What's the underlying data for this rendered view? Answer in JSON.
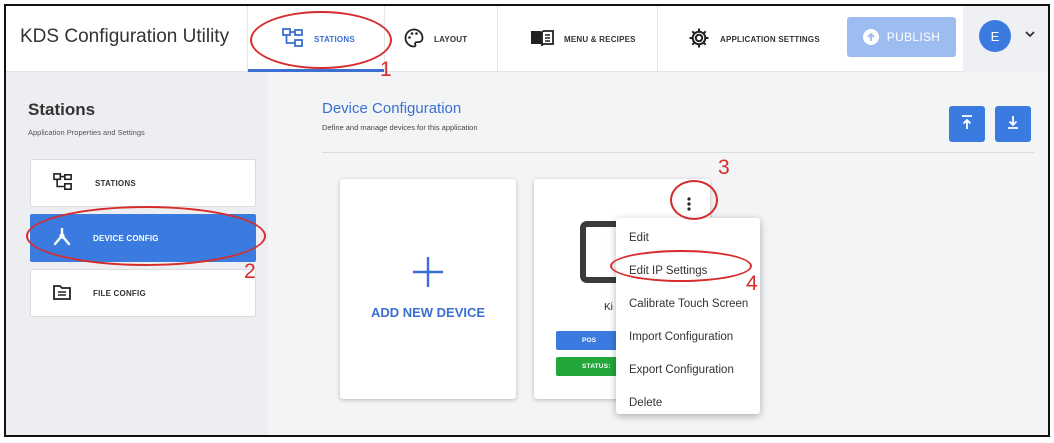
{
  "app": {
    "title": "KDS Configuration Utility"
  },
  "nav": {
    "stations": "STATIONS",
    "layout": "LAYOUT",
    "menu_recipes": "MENU & RECIPES",
    "app_settings": "APPLICATION SETTINGS"
  },
  "publish": {
    "label": "PUBLISH"
  },
  "user": {
    "initial": "E"
  },
  "sidebar": {
    "title": "Stations",
    "subtitle": "Application Properties and Settings",
    "items": [
      {
        "label": "STATIONS",
        "icon": "sitemap-icon",
        "active": false
      },
      {
        "label": "DEVICE CONFIG",
        "icon": "device-network-icon",
        "active": true
      },
      {
        "label": "FILE CONFIG",
        "icon": "file-list-icon",
        "active": false
      }
    ]
  },
  "main": {
    "title": "Device Configuration",
    "subtitle": "Define and manage devices for this application",
    "add_device_label": "ADD NEW DEVICE",
    "device": {
      "name_visible": "Ki",
      "badge1_visible": "POS",
      "badge2_visible": "STATUS:"
    }
  },
  "menu": {
    "items": [
      "Edit",
      "Edit IP Settings",
      "Calibrate Touch Screen",
      "Import Configuration",
      "Export Configuration",
      "Delete"
    ]
  },
  "annotations": [
    "1",
    "2",
    "3",
    "4"
  ],
  "colors": {
    "accent": "#3b7be0",
    "nav_active": "#3b6fd1",
    "publish_disabled": "#9dbcf0",
    "status_green": "#22a83a",
    "annotation_red": "#d62c2c"
  }
}
